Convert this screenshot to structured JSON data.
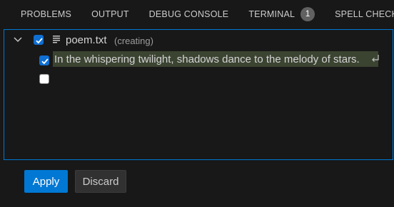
{
  "tabs": [
    {
      "label": "PROBLEMS"
    },
    {
      "label": "OUTPUT"
    },
    {
      "label": "DEBUG CONSOLE"
    },
    {
      "label": "TERMINAL",
      "badge": "1"
    },
    {
      "label": "SPELL CHECKER"
    }
  ],
  "changes": {
    "file": {
      "name": "poem.txt",
      "status": "(creating)",
      "checked": true,
      "icon": "file-lines-icon"
    },
    "lines": [
      {
        "text": "In the whispering twilight, shadows dance to the melody of stars.",
        "checked": true,
        "eol_icon": "newline-return-icon"
      },
      {
        "text": "",
        "checked": false
      }
    ]
  },
  "actions": {
    "apply_label": "Apply",
    "discard_label": "Discard"
  },
  "colors": {
    "accent": "#0078d4",
    "focus_border": "#0078d4",
    "highlight": "#3b4331",
    "background": "#181818"
  }
}
